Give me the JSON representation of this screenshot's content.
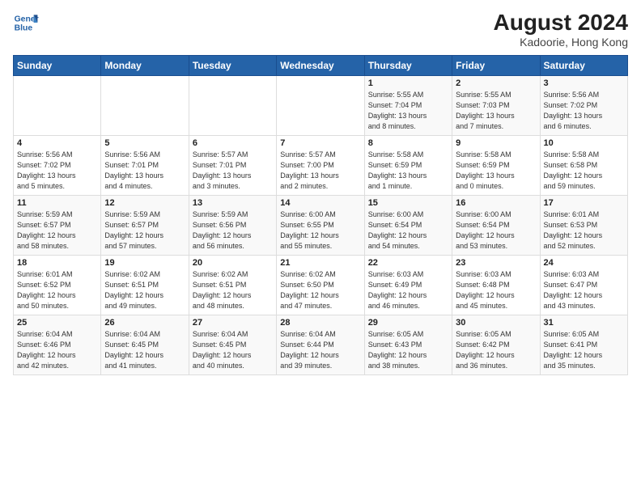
{
  "logo": {
    "line1": "General",
    "line2": "Blue"
  },
  "title": "August 2024",
  "location": "Kadoorie, Hong Kong",
  "days_of_week": [
    "Sunday",
    "Monday",
    "Tuesday",
    "Wednesday",
    "Thursday",
    "Friday",
    "Saturday"
  ],
  "weeks": [
    [
      {
        "day": "",
        "info": ""
      },
      {
        "day": "",
        "info": ""
      },
      {
        "day": "",
        "info": ""
      },
      {
        "day": "",
        "info": ""
      },
      {
        "day": "1",
        "info": "Sunrise: 5:55 AM\nSunset: 7:04 PM\nDaylight: 13 hours\nand 8 minutes."
      },
      {
        "day": "2",
        "info": "Sunrise: 5:55 AM\nSunset: 7:03 PM\nDaylight: 13 hours\nand 7 minutes."
      },
      {
        "day": "3",
        "info": "Sunrise: 5:56 AM\nSunset: 7:02 PM\nDaylight: 13 hours\nand 6 minutes."
      }
    ],
    [
      {
        "day": "4",
        "info": "Sunrise: 5:56 AM\nSunset: 7:02 PM\nDaylight: 13 hours\nand 5 minutes."
      },
      {
        "day": "5",
        "info": "Sunrise: 5:56 AM\nSunset: 7:01 PM\nDaylight: 13 hours\nand 4 minutes."
      },
      {
        "day": "6",
        "info": "Sunrise: 5:57 AM\nSunset: 7:01 PM\nDaylight: 13 hours\nand 3 minutes."
      },
      {
        "day": "7",
        "info": "Sunrise: 5:57 AM\nSunset: 7:00 PM\nDaylight: 13 hours\nand 2 minutes."
      },
      {
        "day": "8",
        "info": "Sunrise: 5:58 AM\nSunset: 6:59 PM\nDaylight: 13 hours\nand 1 minute."
      },
      {
        "day": "9",
        "info": "Sunrise: 5:58 AM\nSunset: 6:59 PM\nDaylight: 13 hours\nand 0 minutes."
      },
      {
        "day": "10",
        "info": "Sunrise: 5:58 AM\nSunset: 6:58 PM\nDaylight: 12 hours\nand 59 minutes."
      }
    ],
    [
      {
        "day": "11",
        "info": "Sunrise: 5:59 AM\nSunset: 6:57 PM\nDaylight: 12 hours\nand 58 minutes."
      },
      {
        "day": "12",
        "info": "Sunrise: 5:59 AM\nSunset: 6:57 PM\nDaylight: 12 hours\nand 57 minutes."
      },
      {
        "day": "13",
        "info": "Sunrise: 5:59 AM\nSunset: 6:56 PM\nDaylight: 12 hours\nand 56 minutes."
      },
      {
        "day": "14",
        "info": "Sunrise: 6:00 AM\nSunset: 6:55 PM\nDaylight: 12 hours\nand 55 minutes."
      },
      {
        "day": "15",
        "info": "Sunrise: 6:00 AM\nSunset: 6:54 PM\nDaylight: 12 hours\nand 54 minutes."
      },
      {
        "day": "16",
        "info": "Sunrise: 6:00 AM\nSunset: 6:54 PM\nDaylight: 12 hours\nand 53 minutes."
      },
      {
        "day": "17",
        "info": "Sunrise: 6:01 AM\nSunset: 6:53 PM\nDaylight: 12 hours\nand 52 minutes."
      }
    ],
    [
      {
        "day": "18",
        "info": "Sunrise: 6:01 AM\nSunset: 6:52 PM\nDaylight: 12 hours\nand 50 minutes."
      },
      {
        "day": "19",
        "info": "Sunrise: 6:02 AM\nSunset: 6:51 PM\nDaylight: 12 hours\nand 49 minutes."
      },
      {
        "day": "20",
        "info": "Sunrise: 6:02 AM\nSunset: 6:51 PM\nDaylight: 12 hours\nand 48 minutes."
      },
      {
        "day": "21",
        "info": "Sunrise: 6:02 AM\nSunset: 6:50 PM\nDaylight: 12 hours\nand 47 minutes."
      },
      {
        "day": "22",
        "info": "Sunrise: 6:03 AM\nSunset: 6:49 PM\nDaylight: 12 hours\nand 46 minutes."
      },
      {
        "day": "23",
        "info": "Sunrise: 6:03 AM\nSunset: 6:48 PM\nDaylight: 12 hours\nand 45 minutes."
      },
      {
        "day": "24",
        "info": "Sunrise: 6:03 AM\nSunset: 6:47 PM\nDaylight: 12 hours\nand 43 minutes."
      }
    ],
    [
      {
        "day": "25",
        "info": "Sunrise: 6:04 AM\nSunset: 6:46 PM\nDaylight: 12 hours\nand 42 minutes."
      },
      {
        "day": "26",
        "info": "Sunrise: 6:04 AM\nSunset: 6:45 PM\nDaylight: 12 hours\nand 41 minutes."
      },
      {
        "day": "27",
        "info": "Sunrise: 6:04 AM\nSunset: 6:45 PM\nDaylight: 12 hours\nand 40 minutes."
      },
      {
        "day": "28",
        "info": "Sunrise: 6:04 AM\nSunset: 6:44 PM\nDaylight: 12 hours\nand 39 minutes."
      },
      {
        "day": "29",
        "info": "Sunrise: 6:05 AM\nSunset: 6:43 PM\nDaylight: 12 hours\nand 38 minutes."
      },
      {
        "day": "30",
        "info": "Sunrise: 6:05 AM\nSunset: 6:42 PM\nDaylight: 12 hours\nand 36 minutes."
      },
      {
        "day": "31",
        "info": "Sunrise: 6:05 AM\nSunset: 6:41 PM\nDaylight: 12 hours\nand 35 minutes."
      }
    ]
  ]
}
